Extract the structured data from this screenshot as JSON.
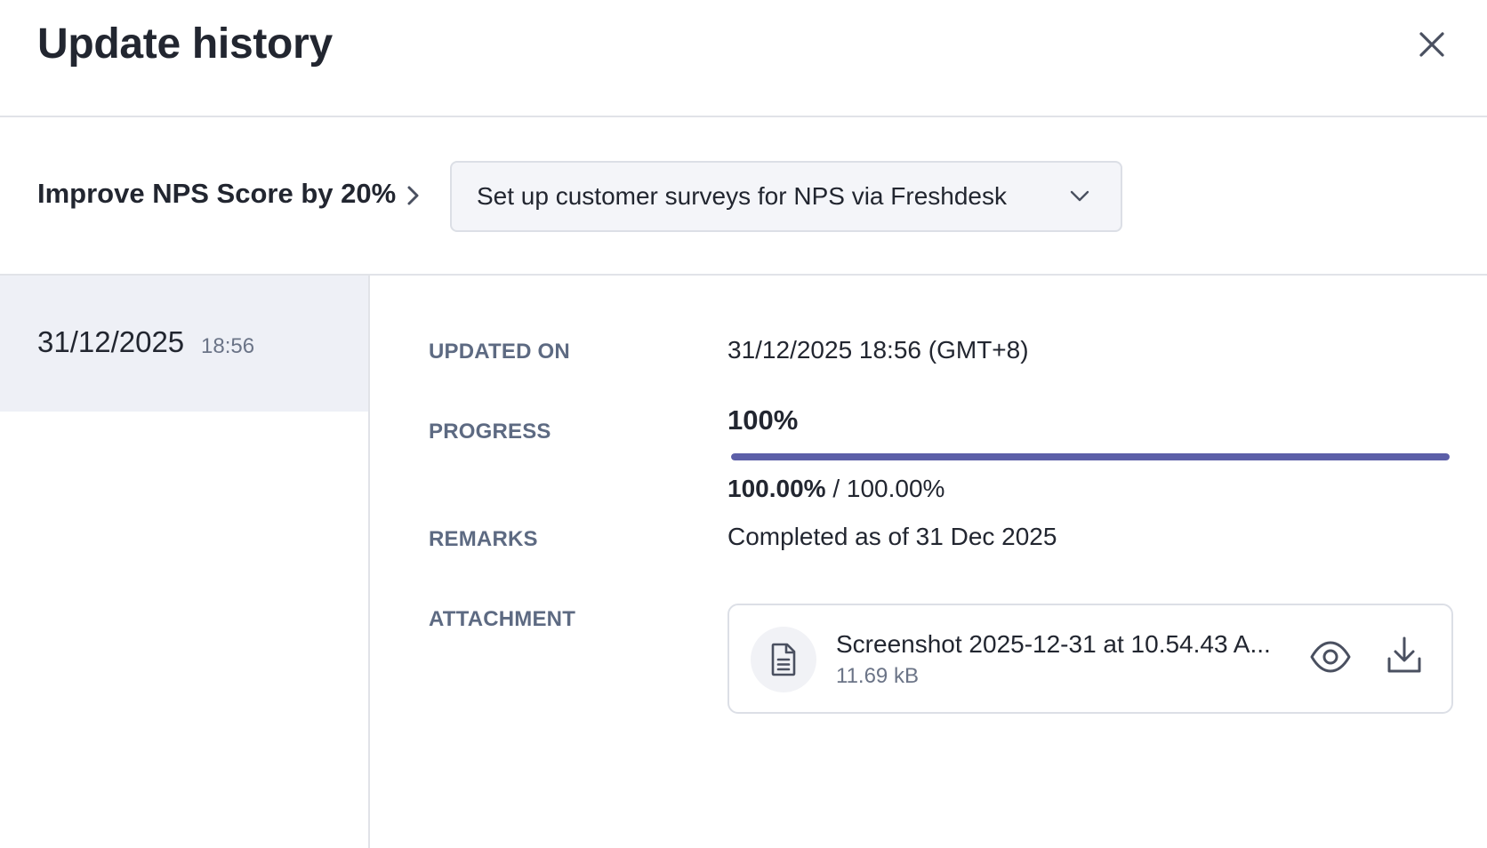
{
  "dialog": {
    "title": "Update history",
    "close_icon": "close-icon"
  },
  "context": {
    "goal": "Improve NPS Score by 20%",
    "separator_icon": "chevron-right-icon",
    "task_select": {
      "value": "Set up customer surveys for NPS via Freshdesk",
      "icon": "chevron-down-icon"
    }
  },
  "history": {
    "entries": [
      {
        "date": "31/12/2025",
        "time": "18:56",
        "selected": true
      }
    ]
  },
  "details": {
    "updated_on": {
      "label": "UPDATED ON",
      "value": "31/12/2025 18:56 (GMT+8)"
    },
    "progress": {
      "label": "PROGRESS",
      "percent_text": "100%",
      "fraction": 1.0,
      "current": "100.00%",
      "separator": " / ",
      "target": "100.00%",
      "bar_color": "#5c5fa8"
    },
    "remarks": {
      "label": "REMARKS",
      "value": "Completed as of 31 Dec 2025"
    },
    "attachment": {
      "label": "ATTACHMENT",
      "file_name": "Screenshot 2025-12-31 at 10.54.43 A...",
      "file_size": "11.69 kB",
      "file_icon": "document-icon",
      "preview_icon": "eye-icon",
      "download_icon": "download-icon"
    }
  }
}
